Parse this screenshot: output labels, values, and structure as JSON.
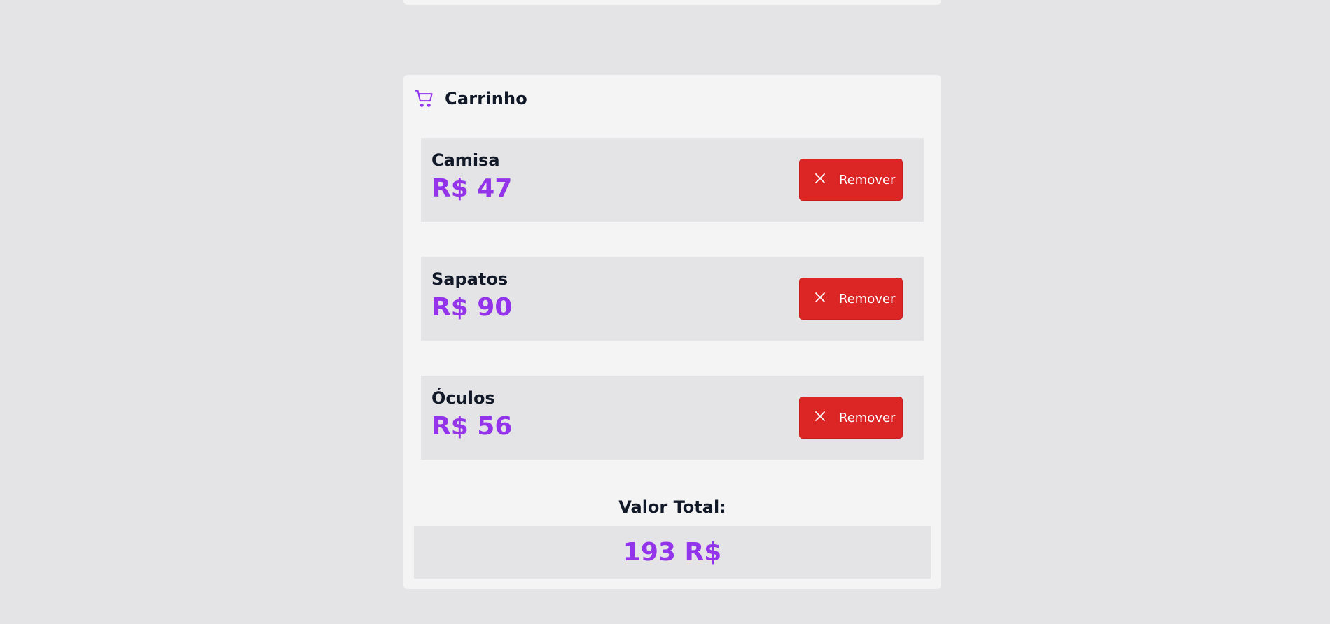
{
  "cart": {
    "title": "Carrinho",
    "items": [
      {
        "name": "Camisa",
        "price": "R$ 47",
        "remove_label": "Remover"
      },
      {
        "name": "Sapatos",
        "price": "R$ 90",
        "remove_label": "Remover"
      },
      {
        "name": "Óculos",
        "price": "R$ 56",
        "remove_label": "Remover"
      }
    ],
    "total_label": "Valor Total:",
    "total_value": "193 R$"
  },
  "icons": {
    "cart": "shopping-cart-icon",
    "remove": "close-icon"
  },
  "colors": {
    "accent": "#9333ea",
    "danger": "#dc2626",
    "background": "#e4e4e7",
    "panel": "#f4f4f5"
  }
}
